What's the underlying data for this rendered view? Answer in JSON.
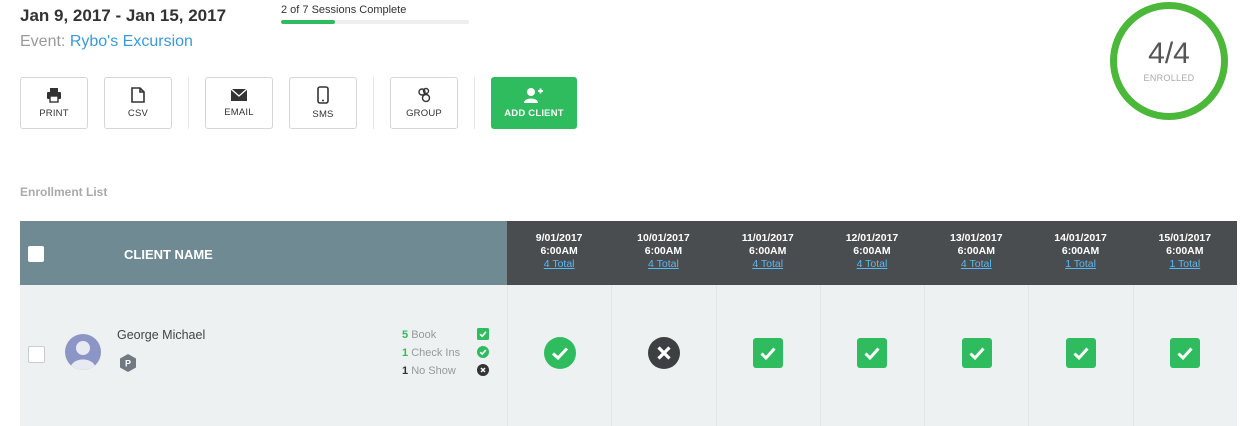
{
  "header": {
    "date_range": "Jan 9, 2017 - Jan 15, 2017",
    "event_label": "Event:",
    "event_name": "Rybo's Excursion",
    "sessions_text": "2 of 7 Sessions Complete",
    "sessions_progress": 0.2857
  },
  "toolbar": {
    "print": "PRINT",
    "csv": "CSV",
    "email": "EMAIL",
    "sms": "SMS",
    "group": "GROUP",
    "add_client": "ADD CLIENT"
  },
  "enrollment": {
    "count": "4/4",
    "label": "ENROLLED",
    "ring_color": "#4cb83a"
  },
  "section_title": "Enrollment List",
  "table": {
    "client_name_header": "CLIENT NAME",
    "columns": [
      {
        "date": "9/01/2017",
        "time": "6:00AM",
        "total": "4 Total"
      },
      {
        "date": "10/01/2017",
        "time": "6:00AM",
        "total": "4 Total"
      },
      {
        "date": "11/01/2017",
        "time": "6:00AM",
        "total": "4 Total"
      },
      {
        "date": "12/01/2017",
        "time": "6:00AM",
        "total": "4 Total"
      },
      {
        "date": "13/01/2017",
        "time": "6:00AM",
        "total": "4 Total"
      },
      {
        "date": "14/01/2017",
        "time": "6:00AM",
        "total": "1 Total"
      },
      {
        "date": "15/01/2017",
        "time": "6:00AM",
        "total": "1 Total"
      }
    ],
    "rows": [
      {
        "name": "George Michael",
        "badge": "P",
        "stats": [
          {
            "count": "5",
            "label": "Book",
            "color": "#2ebc5e",
            "icon": "checkbox-icon"
          },
          {
            "count": "1",
            "label": "Check Ins",
            "color": "#2ebc5e",
            "icon": "check-circle-icon"
          },
          {
            "count": "1",
            "label": "No Show",
            "color": "#333333",
            "icon": "x-circle-icon"
          }
        ],
        "attendance": [
          "check-in",
          "no-show",
          "booked",
          "booked",
          "booked",
          "booked",
          "booked"
        ]
      }
    ]
  },
  "colors": {
    "green": "#2ebc5e",
    "header_left": "#6f8a93",
    "header_right": "#4a4d50",
    "link_blue": "#3a9ad9"
  }
}
